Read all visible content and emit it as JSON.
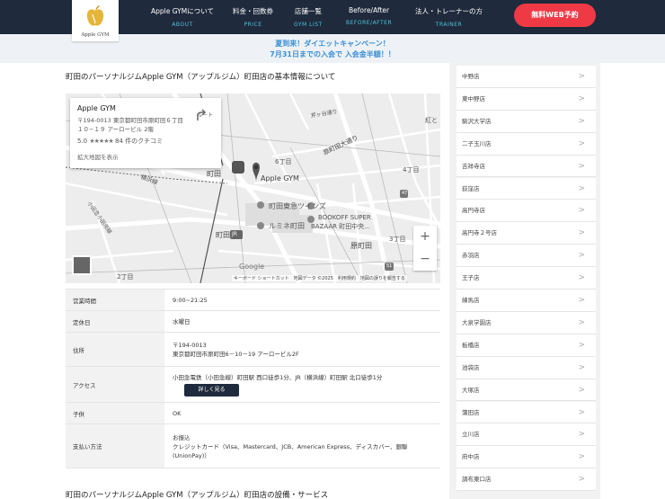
{
  "header": {
    "logo_text": "Apple GYM",
    "nav": [
      {
        "jp": "Apple GYMについて",
        "en": "ABOUT"
      },
      {
        "jp": "料金・回数券",
        "en": "PRICE"
      },
      {
        "jp": "店舗一覧",
        "en": "GYM LIST"
      },
      {
        "jp": "Before/After",
        "en": "BEFORE/AFTER"
      },
      {
        "jp": "法人・トレーナーの方",
        "en": "TRAINER"
      }
    ],
    "reserve_button": "無料WEB予約"
  },
  "campaign": {
    "line1": "夏到来！ダイエットキャンペーン！",
    "line2": "7月31日までの入会で 入会金半額！！"
  },
  "main": {
    "title": "町田のパーソナルジムApple GYM（アップルジム）町田店の基本情報について",
    "next_title": "町田のパーソナルジムApple GYM（アップルジム）町田店の設備・サービス"
  },
  "map": {
    "card_name": "Apple GYM",
    "card_address": "〒194-0013 東京都町田市原町田６丁目１０−１９ アーロービル 2階",
    "rating": "5.0",
    "stars": "★★★★★",
    "reviews": "84 件のクチコミ",
    "route_label": "ルート",
    "enlarge_link": "拡大地図を表示",
    "zoom_in": "+",
    "zoom_out": "−",
    "google": "Google",
    "attribution": "キーボード ショートカット　地図データ ©2025　利用規約　地図の誤りを報告する",
    "labels": {
      "pin": "Apple GYM",
      "machida": "町田",
      "machida_jr": "町田",
      "jr": "JR",
      "tokyu": "町田東急ツインズ",
      "lumine": "ルミネ町田",
      "bookoff1": "BOOKOFF SUPER",
      "bookoff2": "BAZAAR 町田中央...",
      "haramachida": "原町田",
      "haramachida_st": "原町田大通り",
      "chome6": "6丁目",
      "chome4": "4丁目",
      "chome3": "3丁目",
      "chome2": "2丁目",
      "yokohama": "横浜線",
      "kou": "紅と",
      "road47": "47",
      "road51": "51",
      "odakyu": "小田急小田原線",
      "sakai": "芹ヶ谷通り"
    }
  },
  "info": [
    {
      "label": "営業時間",
      "lines": [
        "9:00~21:25"
      ]
    },
    {
      "label": "定休日",
      "lines": [
        "水曜日"
      ]
    },
    {
      "label": "住所",
      "lines": [
        "〒194-0013",
        "東京都町田市原町田6－10－19 アーロービル2F"
      ]
    },
    {
      "label": "アクセス",
      "lines": [
        "小田急電鉄（小田急線）町田駅 西口徒歩1分、JR（横浜線）町田駅 北口徒歩1分"
      ],
      "button": "詳しく見る"
    },
    {
      "label": "子供",
      "lines": [
        "OK"
      ]
    },
    {
      "label": "支払い方法",
      "lines": [
        "お振込",
        "クレジットカード（Visa、Mastercard、JCB、American Express、ディスカバー、銀聯",
        "(UnionPay)）"
      ]
    }
  ],
  "sidebar": {
    "items": [
      "中野店",
      "東中野店",
      "駒沢大学店",
      "二子玉川店",
      "吉祥寺店",
      "荻窪店",
      "高円寺店",
      "高円寺２号店",
      "赤羽店",
      "王子店",
      "練馬店",
      "大泉学園店",
      "板橋店",
      "池袋店",
      "大塚店",
      "蒲田店",
      "立川店",
      "府中店",
      "調布東口店"
    ],
    "arrow": ">"
  },
  "colors": {
    "header_bg": "#1f2a3c",
    "nav_en": "#4fc3dc",
    "reserve": "#ef3a46",
    "campaign_text": "#3a8fd6"
  }
}
